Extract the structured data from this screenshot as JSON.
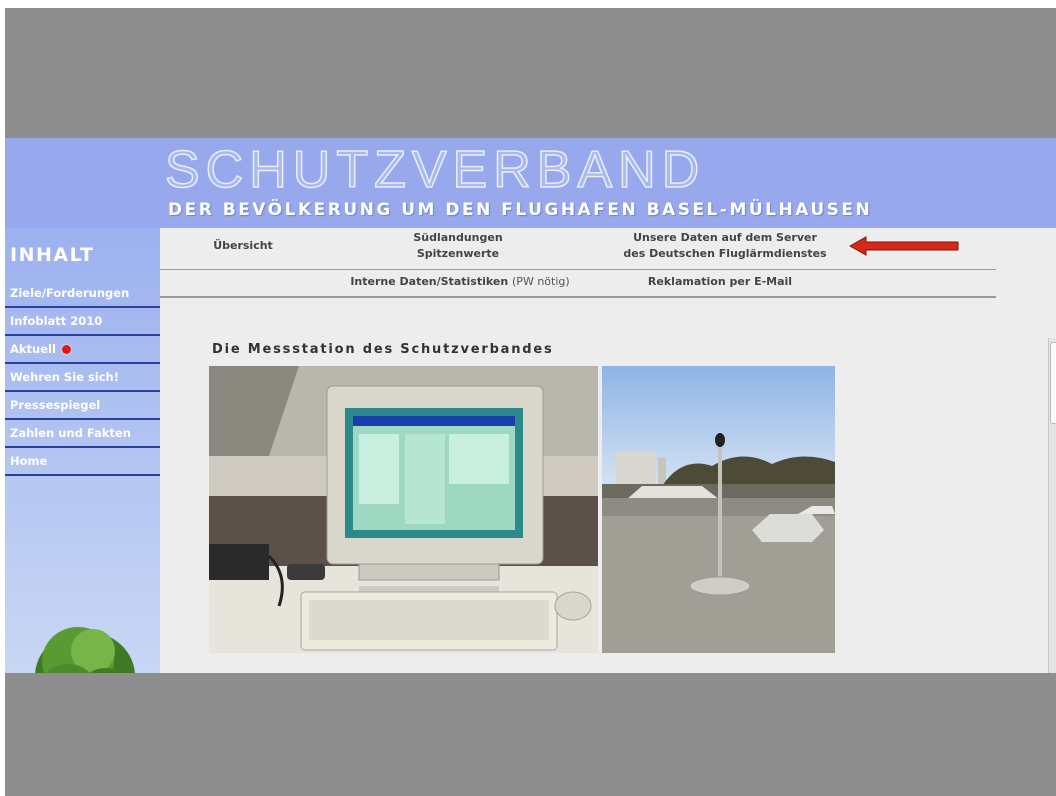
{
  "header": {
    "title": "SCHUTZVERBAND",
    "subtitle": "DER BEVÖLKERUNG UM DEN FLUGHAFEN BASEL-MÜLHAUSEN"
  },
  "sidebar": {
    "heading": "INHALT",
    "items": [
      {
        "label": "Ziele/Forderungen"
      },
      {
        "label": "Infoblatt 2010"
      },
      {
        "label": "Aktuell"
      },
      {
        "label": "Wehren Sie sich!"
      },
      {
        "label": "Pressespiegel"
      },
      {
        "label": "Zahlen und Fakten"
      },
      {
        "label": "Home"
      }
    ]
  },
  "topnav": {
    "uebersicht": "Übersicht",
    "suedlandungen_line1": "Südlandungen",
    "suedlandungen_line2": "Spitzenwerte",
    "server_line1": "Unsere Daten auf dem Server",
    "server_line2": "des Deutschen Fluglärmdienstes",
    "interne": "Interne Daten/Statistiken",
    "interne_note": "(PW nötig)",
    "reklamation": "Reklamation per E-Mail"
  },
  "content": {
    "section_title": "Die Messstation des Schutzverbandes"
  },
  "colors": {
    "banner": "#97a8ec",
    "sidebar_rule": "#2d3f9e",
    "accent_red": "#e01818",
    "page_bg": "#ededed"
  }
}
